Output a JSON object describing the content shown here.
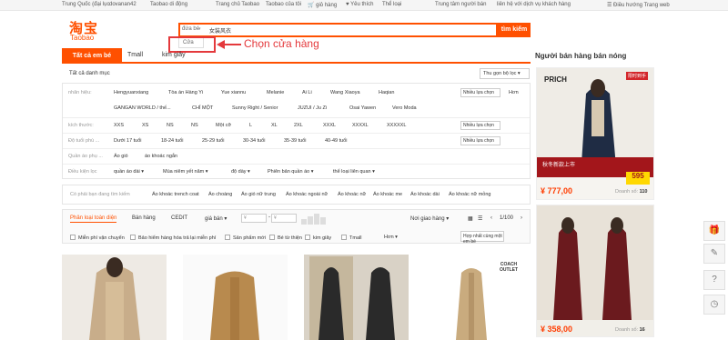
{
  "topbar": {
    "region": "Trung Quốc (đại lục",
    "user": "dovanan42",
    "messages": "Taobao di động",
    "home": "Trang chủ Taobao",
    "my_taobao": "Taobao của tôi",
    "cart": "giỏ hàng",
    "favorites": "Yêu thích",
    "categories": "Thể loại",
    "seller_center": "Trung tâm người bán",
    "contact": "liên hệ với dịch vụ khách hàng",
    "nav": "Điều hướng Trang web"
  },
  "logo": {
    "cn": "淘宝",
    "en": "Taobao"
  },
  "search": {
    "scope": "đứa bé",
    "query": "女装风衣",
    "button": "tìm kiếm",
    "dropdown_option": "Cửa"
  },
  "callout": "Chọn cửa hàng",
  "tabs": {
    "active": "Tất cả em bé",
    "tmall": "Tmall",
    "second": "kim giây"
  },
  "crumb": "Tất cả danh mục",
  "collapse": "Thu gọn bộ lọc",
  "filters": [
    {
      "label": "nhãn hiệu:",
      "values": [
        "Hengyuanxiang",
        "Tòa án Hàng Yi",
        "Yue xiannu",
        "Melanie",
        "Ai Li",
        "Wang Xiaoya",
        "Haqian"
      ],
      "values2": [
        "GANGAN WORLD / thế...",
        "CHỈ MỘT",
        "Sunny Right / Senior",
        "JUZUI / Ju Zi",
        "Osai Yawen",
        "Vero Moda"
      ],
      "btn": "Nhiều lựa chọn",
      "more": "Hơn"
    },
    {
      "label": "kích thước:",
      "values": [
        "XXS",
        "XS",
        "NS",
        "NS",
        "Một cỡ",
        "L",
        "XL",
        "2XL",
        "XXXL",
        "XXXXL",
        "XXXXXL"
      ],
      "btn": "Nhiều lựa chọn"
    },
    {
      "label": "Độ tuổi phù ...",
      "values": [
        "Dưới 17 tuổi",
        "18-24 tuổi",
        "25-29 tuổi",
        "30-34 tuổi",
        "35-39 tuổi",
        "40-49 tuổi"
      ],
      "btn": "Nhiều lựa chọn"
    },
    {
      "label": "Quần áo phụ ...",
      "values": [
        "Áo gió",
        "áo khoác ngắn"
      ]
    },
    {
      "label": "Điều kiện lọc",
      "values": [
        "quần áo dài",
        "Mùa niêm yết năm",
        "độ dày",
        "Phiên bản quần áo",
        "thể loại liên quan"
      ]
    }
  ],
  "suggest": {
    "label": "Có phải bạn đang tìm kiếm",
    "items": [
      "Áo khoác trench coat",
      "Áo choàng",
      "Áo gió nữ trung",
      "Áo khoác ngoài nữ",
      "Áo khoác nữ",
      "Áo khoác me",
      "Áo khoác dài",
      "Áo khoác nữ mỏng"
    ]
  },
  "sort": {
    "items": [
      "Phân loại toàn diện",
      "Bán hàng",
      "CEDIT",
      "giá bán"
    ],
    "price_from": "¥",
    "price_to": "¥",
    "shipping": "Nơi giao hàng",
    "page": "1/100"
  },
  "checks": [
    "Miễn phí vận chuyển",
    "Bảo hiểm hàng hóa trả lại miễn phí",
    "Sản phẩm mới",
    "Bé từ thiện",
    "kim giây",
    "Tmall",
    "Hơn"
  ],
  "sort_btn": "Hợp nhất cùng một em bé",
  "product_badge": "COACH OUTLET",
  "sidebar": {
    "title": "Người bán hàng bán nóng",
    "items": [
      {
        "brand": "PRICH",
        "badge": "限时到手",
        "price": "¥ 777,00",
        "sold_label": "Doanh số:",
        "sold": "110",
        "promo": "秋冬新款上市",
        "sub": "¥595",
        "tag": "595"
      },
      {
        "price": "¥ 358,00",
        "sold_label": "Doanh số:",
        "sold": "16"
      }
    ]
  },
  "floatbar": [
    "gift-icon",
    "edit-icon",
    "help-icon",
    "history-icon"
  ],
  "colors": {
    "brand": "#ff5000",
    "accent": "#e4393c"
  }
}
